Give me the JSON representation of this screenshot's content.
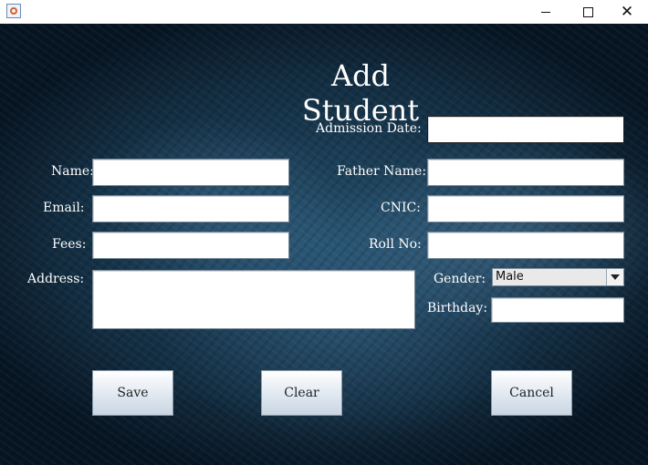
{
  "window": {
    "app_icon": "java-coffee-icon",
    "controls": {
      "minimize": "minimize-icon",
      "maximize": "maximize-icon",
      "close": "close-icon"
    }
  },
  "form": {
    "title": "Add Student",
    "labels": {
      "admission_date": "Admission Date:",
      "name": "Name:",
      "father_name": "Father Name:",
      "email": "Email:",
      "cnic": "CNIC:",
      "fees": "Fees:",
      "roll_no": "Roll No:",
      "address": "Address:",
      "gender": "Gender:",
      "birthday": "Birthday:"
    },
    "values": {
      "admission_date": "",
      "name": "",
      "father_name": "",
      "email": "",
      "cnic": "",
      "fees": "",
      "roll_no": "",
      "address": "",
      "gender": "Male",
      "birthday": ""
    },
    "buttons": {
      "save": "Save",
      "clear": "Clear",
      "cancel": "Cancel"
    }
  },
  "colors": {
    "background": "#163a55",
    "label_text": "#ffffff"
  }
}
